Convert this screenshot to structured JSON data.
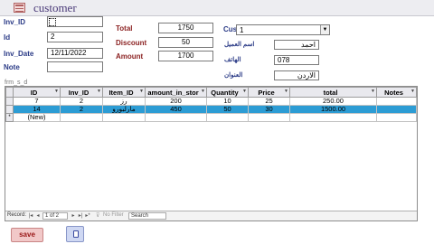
{
  "form": {
    "title": "customer"
  },
  "fields": {
    "inv_id": {
      "label": "Inv_ID",
      "value": ""
    },
    "id": {
      "label": "Id",
      "value": "2"
    },
    "inv_date": {
      "label": "Inv_Date",
      "value": "12/11/2022"
    },
    "note": {
      "label": "Note",
      "value": ""
    },
    "total": {
      "label": "Total",
      "value": "1750"
    },
    "discount": {
      "label": "Discount",
      "value": "50"
    },
    "amount": {
      "label": "Amount",
      "value": "1700"
    },
    "cus_id": {
      "label": "Cus_ID",
      "value": "1"
    },
    "customer_name": {
      "label": "اسم العميل",
      "value": "احمد"
    },
    "phone": {
      "label": "الهاتف",
      "value": "078"
    },
    "address": {
      "label": "العنوان",
      "value": "الاردن"
    }
  },
  "subform": {
    "label": "frm_s_d",
    "columns": [
      "ID",
      "Inv_ID",
      "Item_ID",
      "amount_in_stor",
      "Quantity",
      "Price",
      "total",
      "Notes"
    ],
    "rows": [
      {
        "id": "7",
        "inv_id": "2",
        "item_id": "رز",
        "amount_in_stor": "200",
        "quantity": "10",
        "price": "25",
        "total": "250.00",
        "notes": ""
      },
      {
        "id": "14",
        "inv_id": "2",
        "item_id": "مارلبورو",
        "amount_in_stor": "450",
        "quantity": "50",
        "price": "30",
        "total": "1500.00",
        "notes": ""
      }
    ],
    "new_row_label": "(New)",
    "navigation": {
      "record_label": "Record:",
      "position": "1 of 2",
      "filter_label": "No Filter",
      "search_placeholder": "Search"
    }
  },
  "buttons": {
    "save_label": "save"
  },
  "colors": {
    "selected_row": "#2c9cd4",
    "label_blue": "#2a3a86",
    "label_red": "#8a1f1f",
    "save_button": "#f1c8c8"
  }
}
